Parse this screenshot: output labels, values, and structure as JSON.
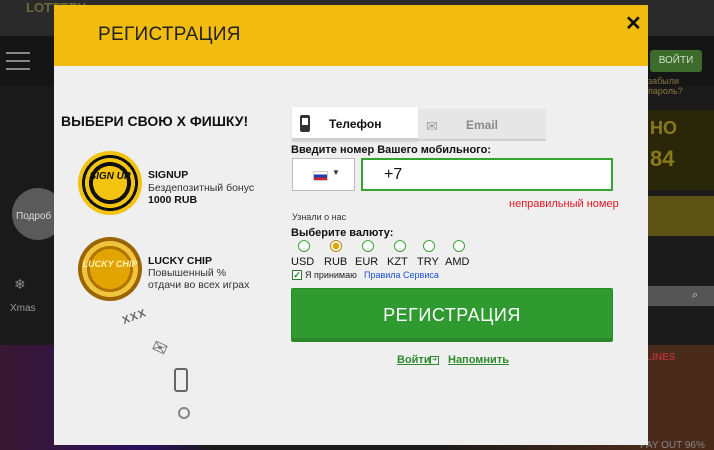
{
  "background": {
    "logo": "LOTTERY",
    "enter_button": "ВОЙТИ",
    "forgot_link": "забыли пароль?",
    "left_label": "Подроб",
    "xmas_label": "Xmas",
    "right_big1": "НО",
    "right_big2": "84",
    "lines_label": "LINES",
    "payout_label": "PAY OUT 96%"
  },
  "modal": {
    "title": "РЕГИСТРАЦИЯ",
    "close_label": "✕",
    "promo": {
      "title": "ВЫБЕРИ СВОЮ Х ФИШКУ!",
      "chips": [
        {
          "chip_text": "SIGN UP",
          "name": "SIGNUP",
          "description": "Бездепозитный бонус",
          "amount": "1000 RUB"
        },
        {
          "chip_text": "LUCKY CHIP",
          "name": "LUCKY CHIP",
          "description_line1": "Повышенный %",
          "description_line2": "отдачи во всех играх"
        }
      ],
      "deco_text": "XXX"
    },
    "tabs": {
      "phone_label": "Телефон",
      "email_label": "Email",
      "active": "phone"
    },
    "phone_field": {
      "label": "Введите номер Вашего мобильного:",
      "country": "RU",
      "value": "+7",
      "error": "неправильный номер"
    },
    "heard_label": "Узнали о нас",
    "currency": {
      "label": "Выберите валюту:",
      "options": [
        "USD",
        "RUB",
        "EUR",
        "KZT",
        "TRY",
        "AMD"
      ],
      "selected": "RUB"
    },
    "agree": {
      "checked": true,
      "text": "Я принимаю",
      "link": "Правила Сервиса"
    },
    "submit_label": "РЕГИСТРАЦИЯ",
    "login_link": "Войти",
    "remind_link": "Напомнить"
  },
  "colors": {
    "header": "#f2bc0f",
    "primary_green": "#2f9a2f",
    "error": "#e0141e",
    "link_blue": "#1a4fd6"
  }
}
